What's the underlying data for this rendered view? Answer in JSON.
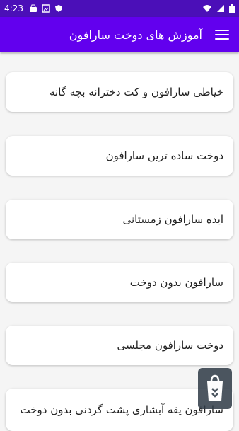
{
  "status": {
    "time": "4:23"
  },
  "appbar": {
    "title": "آموزش های دوخت سارافون"
  },
  "items": [
    {
      "label": "خیاطی سارافون و کت دخترانه بچه گانه"
    },
    {
      "label": "دوخت ساده ترین سارافون"
    },
    {
      "label": "ایده سارافون زمستانی"
    },
    {
      "label": "سارافون بدون دوخت"
    },
    {
      "label": "دوخت سارافون مجلسی"
    },
    {
      "label": "سارافون یقه آبشاری پشت گردنی بدون دوخت"
    }
  ]
}
